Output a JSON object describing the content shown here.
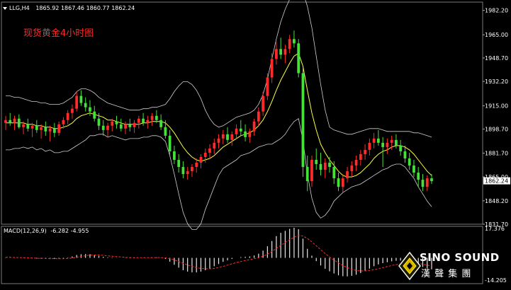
{
  "window": {
    "symbol_line": "LLG,H4",
    "ohlc": "1865.92 1867.46 1860.77 1862.24",
    "title_cn": "现货黄金4小时图"
  },
  "colors": {
    "background": "#000000",
    "bull": "#ff2a2a",
    "bear": "#45e03a",
    "bollinger": "#d0d0d0",
    "ma": "#ffff40",
    "grid": "#404040",
    "text": "#ffffff",
    "macd_signal": "#ff2a2a",
    "price_box": "#ffffff"
  },
  "logo": {
    "name": "SINO SOUND",
    "name_cn": "漢 聲 集 團",
    "icon": "diamond-logo-icon"
  },
  "chart_data": [
    {
      "type": "candlestick",
      "title": "现货黄金4小时图",
      "symbol": "LLG,H4",
      "yticks": [
        1982.2,
        1965.0,
        1948.7,
        1932.2,
        1915.0,
        1898.7,
        1881.7,
        1865.0,
        1848.2,
        1831.7
      ],
      "ylim": [
        1831.7,
        1988.0
      ],
      "current_price": 1862.24,
      "grid": false,
      "candles": [
        [
          1903,
          1908,
          1898,
          1905
        ],
        [
          1905,
          1910,
          1901,
          1903
        ],
        [
          1903,
          1908,
          1898,
          1906
        ],
        [
          1906,
          1909,
          1899,
          1900
        ],
        [
          1900,
          1904,
          1895,
          1902
        ],
        [
          1902,
          1906,
          1897,
          1899
        ],
        [
          1899,
          1903,
          1893,
          1901
        ],
        [
          1901,
          1905,
          1896,
          1898
        ],
        [
          1898,
          1902,
          1892,
          1900
        ],
        [
          1900,
          1904,
          1894,
          1897
        ],
        [
          1897,
          1901,
          1890,
          1899
        ],
        [
          1899,
          1903,
          1893,
          1896
        ],
        [
          1896,
          1904,
          1894,
          1902
        ],
        [
          1902,
          1907,
          1899,
          1905
        ],
        [
          1905,
          1912,
          1902,
          1910
        ],
        [
          1910,
          1916,
          1906,
          1913
        ],
        [
          1913,
          1925,
          1911,
          1922
        ],
        [
          1922,
          1926,
          1915,
          1917
        ],
        [
          1917,
          1921,
          1911,
          1914
        ],
        [
          1914,
          1919,
          1908,
          1911
        ],
        [
          1911,
          1915,
          1904,
          1906
        ],
        [
          1906,
          1910,
          1898,
          1901
        ],
        [
          1901,
          1905,
          1894,
          1898
        ],
        [
          1898,
          1903,
          1893,
          1901
        ],
        [
          1901,
          1906,
          1897,
          1904
        ],
        [
          1904,
          1908,
          1899,
          1902
        ],
        [
          1902,
          1906,
          1897,
          1899
        ],
        [
          1899,
          1904,
          1895,
          1902
        ],
        [
          1902,
          1906,
          1897,
          1900
        ],
        [
          1900,
          1905,
          1896,
          1903
        ],
        [
          1903,
          1908,
          1899,
          1906
        ],
        [
          1906,
          1910,
          1901,
          1903
        ],
        [
          1903,
          1908,
          1899,
          1905
        ],
        [
          1905,
          1910,
          1901,
          1908
        ],
        [
          1908,
          1912,
          1903,
          1905
        ],
        [
          1905,
          1909,
          1898,
          1900
        ],
        [
          1900,
          1905,
          1892,
          1894
        ],
        [
          1894,
          1898,
          1880,
          1883
        ],
        [
          1883,
          1887,
          1874,
          1877
        ],
        [
          1877,
          1881,
          1868,
          1872
        ],
        [
          1872,
          1876,
          1864,
          1867
        ],
        [
          1867,
          1872,
          1863,
          1869
        ],
        [
          1869,
          1874,
          1865,
          1872
        ],
        [
          1872,
          1878,
          1868,
          1875
        ],
        [
          1875,
          1881,
          1871,
          1879
        ],
        [
          1879,
          1885,
          1875,
          1882
        ],
        [
          1882,
          1888,
          1878,
          1885
        ],
        [
          1885,
          1892,
          1881,
          1889
        ],
        [
          1889,
          1895,
          1885,
          1892
        ],
        [
          1892,
          1898,
          1888,
          1895
        ],
        [
          1895,
          1900,
          1889,
          1891
        ],
        [
          1891,
          1897,
          1887,
          1895
        ],
        [
          1895,
          1902,
          1892,
          1899
        ],
        [
          1899,
          1905,
          1894,
          1897
        ],
        [
          1897,
          1902,
          1890,
          1893
        ],
        [
          1893,
          1899,
          1889,
          1897
        ],
        [
          1897,
          1906,
          1894,
          1904
        ],
        [
          1904,
          1914,
          1901,
          1911
        ],
        [
          1911,
          1925,
          1908,
          1922
        ],
        [
          1922,
          1938,
          1919,
          1935
        ],
        [
          1935,
          1952,
          1931,
          1948
        ],
        [
          1948,
          1960,
          1944,
          1955
        ],
        [
          1955,
          1963,
          1948,
          1951
        ],
        [
          1951,
          1958,
          1945,
          1955
        ],
        [
          1955,
          1965,
          1952,
          1962
        ],
        [
          1962,
          1968,
          1956,
          1959
        ],
        [
          1959,
          1962,
          1935,
          1938
        ],
        [
          1938,
          1942,
          1865,
          1872
        ],
        [
          1872,
          1880,
          1855,
          1862
        ],
        [
          1862,
          1880,
          1858,
          1877
        ],
        [
          1877,
          1885,
          1870,
          1874
        ],
        [
          1874,
          1882,
          1866,
          1870
        ],
        [
          1870,
          1878,
          1864,
          1875
        ],
        [
          1875,
          1879,
          1868,
          1872
        ],
        [
          1872,
          1876,
          1860,
          1864
        ],
        [
          1864,
          1868,
          1855,
          1858
        ],
        [
          1858,
          1867,
          1854,
          1864
        ],
        [
          1864,
          1872,
          1861,
          1869
        ],
        [
          1869,
          1876,
          1865,
          1873
        ],
        [
          1873,
          1880,
          1869,
          1877
        ],
        [
          1877,
          1884,
          1873,
          1881
        ],
        [
          1881,
          1888,
          1877,
          1884
        ],
        [
          1884,
          1892,
          1880,
          1889
        ],
        [
          1889,
          1896,
          1885,
          1892
        ],
        [
          1892,
          1898,
          1887,
          1889
        ],
        [
          1889,
          1893,
          1872,
          1886
        ],
        [
          1886,
          1892,
          1881,
          1889
        ],
        [
          1889,
          1894,
          1884,
          1891
        ],
        [
          1891,
          1895,
          1885,
          1887
        ],
        [
          1887,
          1891,
          1880,
          1883
        ],
        [
          1883,
          1887,
          1875,
          1878
        ],
        [
          1878,
          1882,
          1870,
          1873
        ],
        [
          1873,
          1877,
          1865,
          1868
        ],
        [
          1868,
          1872,
          1858,
          1863
        ],
        [
          1863,
          1867,
          1855,
          1858
        ],
        [
          1858,
          1866,
          1855,
          1864
        ],
        [
          1864,
          1867,
          1860,
          1862
        ]
      ],
      "ma": [
        1903,
        1903,
        1903,
        1903,
        1903,
        1902,
        1902,
        1901,
        1901,
        1900,
        1900,
        1899,
        1899,
        1900,
        1901,
        1903,
        1906,
        1908,
        1909,
        1910,
        1909,
        1908,
        1907,
        1905,
        1905,
        1904,
        1903,
        1902,
        1902,
        1902,
        1902,
        1903,
        1903,
        1904,
        1904,
        1904,
        1903,
        1900,
        1896,
        1891,
        1886,
        1882,
        1879,
        1877,
        1876,
        1877,
        1878,
        1880,
        1883,
        1886,
        1888,
        1890,
        1892,
        1894,
        1895,
        1896,
        1898,
        1901,
        1905,
        1911,
        1918,
        1926,
        1933,
        1939,
        1945,
        1950,
        1952,
        1943,
        1926,
        1910,
        1898,
        1888,
        1882,
        1877,
        1873,
        1869,
        1866,
        1865,
        1865,
        1866,
        1868,
        1871,
        1874,
        1878,
        1881,
        1883,
        1884,
        1886,
        1887,
        1887,
        1886,
        1884,
        1881,
        1877,
        1873,
        1869,
        1866
      ],
      "bb_upper": [
        1922,
        1922,
        1921,
        1921,
        1920,
        1919,
        1918,
        1918,
        1917,
        1917,
        1916,
        1916,
        1916,
        1917,
        1919,
        1921,
        1925,
        1927,
        1927,
        1926,
        1924,
        1921,
        1919,
        1917,
        1916,
        1915,
        1914,
        1913,
        1912,
        1912,
        1912,
        1913,
        1913,
        1914,
        1914,
        1915,
        1916,
        1920,
        1925,
        1929,
        1932,
        1932,
        1930,
        1926,
        1920,
        1912,
        1906,
        1902,
        1900,
        1901,
        1903,
        1905,
        1907,
        1908,
        1909,
        1910,
        1912,
        1916,
        1923,
        1934,
        1948,
        1962,
        1974,
        1983,
        1990,
        1996,
        1998,
        1995,
        1985,
        1970,
        1950,
        1930,
        1912,
        1900,
        1898,
        1897,
        1896,
        1895,
        1895,
        1896,
        1897,
        1898,
        1899,
        1899,
        1899,
        1898,
        1897,
        1897,
        1897,
        1897,
        1897,
        1897,
        1896,
        1896,
        1895,
        1894,
        1893
      ],
      "bb_lower": [
        1884,
        1884,
        1885,
        1885,
        1886,
        1885,
        1886,
        1884,
        1885,
        1883,
        1884,
        1882,
        1882,
        1883,
        1883,
        1885,
        1887,
        1889,
        1891,
        1894,
        1894,
        1895,
        1895,
        1893,
        1894,
        1893,
        1892,
        1891,
        1892,
        1892,
        1892,
        1893,
        1893,
        1894,
        1894,
        1893,
        1890,
        1880,
        1867,
        1853,
        1840,
        1832,
        1828,
        1828,
        1832,
        1842,
        1850,
        1858,
        1866,
        1871,
        1873,
        1875,
        1877,
        1880,
        1881,
        1882,
        1884,
        1886,
        1887,
        1888,
        1888,
        1890,
        1892,
        1895,
        1900,
        1904,
        1906,
        1891,
        1867,
        1850,
        1840,
        1836,
        1838,
        1842,
        1848,
        1851,
        1854,
        1856,
        1858,
        1859,
        1860,
        1862,
        1864,
        1866,
        1868,
        1870,
        1871,
        1873,
        1874,
        1874,
        1872,
        1868,
        1864,
        1858,
        1853,
        1848,
        1844
      ]
    },
    {
      "type": "bar",
      "title": "MACD(12,26,9) -6.282 -4.955",
      "indicator": "MACD(12,26,9)",
      "values_text": "-6.282 -4.955",
      "yticks_labels": [
        "17.376",
        "-14.205"
      ],
      "ylim": [
        -14.205,
        17.376
      ],
      "macd": [
        0.2,
        0.1,
        0.1,
        0.0,
        -0.1,
        -0.2,
        -0.3,
        -0.4,
        -0.5,
        -0.5,
        -0.6,
        -0.6,
        -0.5,
        -0.3,
        0.2,
        0.8,
        1.6,
        2.0,
        2.1,
        2.0,
        1.6,
        1.1,
        0.6,
        0.3,
        0.2,
        0.1,
        0.0,
        -0.1,
        -0.1,
        -0.1,
        0.0,
        0.1,
        0.2,
        0.3,
        0.3,
        0.1,
        -0.6,
        -2.1,
        -3.8,
        -5.4,
        -6.8,
        -7.6,
        -8.0,
        -8.0,
        -7.6,
        -6.8,
        -5.8,
        -4.6,
        -3.4,
        -2.2,
        -1.4,
        -0.6,
        0.0,
        0.4,
        0.6,
        0.8,
        1.3,
        2.3,
        4.0,
        6.4,
        9.3,
        12.0,
        13.8,
        14.9,
        16.0,
        16.6,
        15.8,
        10.6,
        5.0,
        1.2,
        -1.8,
        -4.2,
        -6.0,
        -7.4,
        -8.6,
        -9.6,
        -10.1,
        -10.2,
        -9.9,
        -9.3,
        -8.4,
        -7.2,
        -5.9,
        -4.6,
        -3.6,
        -2.9,
        -2.4,
        -1.9,
        -1.6,
        -1.5,
        -1.8,
        -2.4,
        -3.2,
        -4.1,
        -5.0,
        -5.8,
        -6.3
      ],
      "signal": [
        0.3,
        0.3,
        0.2,
        0.2,
        0.1,
        0.0,
        -0.1,
        -0.2,
        -0.2,
        -0.3,
        -0.4,
        -0.4,
        -0.5,
        -0.5,
        -0.3,
        -0.1,
        0.3,
        0.8,
        1.2,
        1.5,
        1.6,
        1.6,
        1.4,
        1.1,
        0.9,
        0.7,
        0.5,
        0.3,
        0.2,
        0.1,
        0.1,
        0.1,
        0.1,
        0.1,
        0.2,
        0.2,
        0.0,
        -0.4,
        -1.1,
        -2.0,
        -3.0,
        -3.9,
        -4.7,
        -5.4,
        -5.8,
        -6.0,
        -6.0,
        -5.8,
        -5.3,
        -4.7,
        -4.0,
        -3.3,
        -2.6,
        -2.0,
        -1.5,
        -1.0,
        -0.5,
        0.1,
        0.9,
        2.0,
        3.5,
        5.2,
        6.9,
        8.5,
        10.0,
        11.4,
        12.3,
        12.0,
        10.7,
        8.8,
        6.7,
        4.5,
        2.4,
        0.5,
        -1.2,
        -2.8,
        -4.2,
        -5.4,
        -6.3,
        -6.9,
        -7.2,
        -7.2,
        -6.9,
        -6.5,
        -6.0,
        -5.4,
        -4.8,
        -4.2,
        -3.7,
        -3.3,
        -3.0,
        -2.9,
        -2.9,
        -3.1,
        -3.5,
        -4.0,
        -4.5
      ]
    }
  ]
}
